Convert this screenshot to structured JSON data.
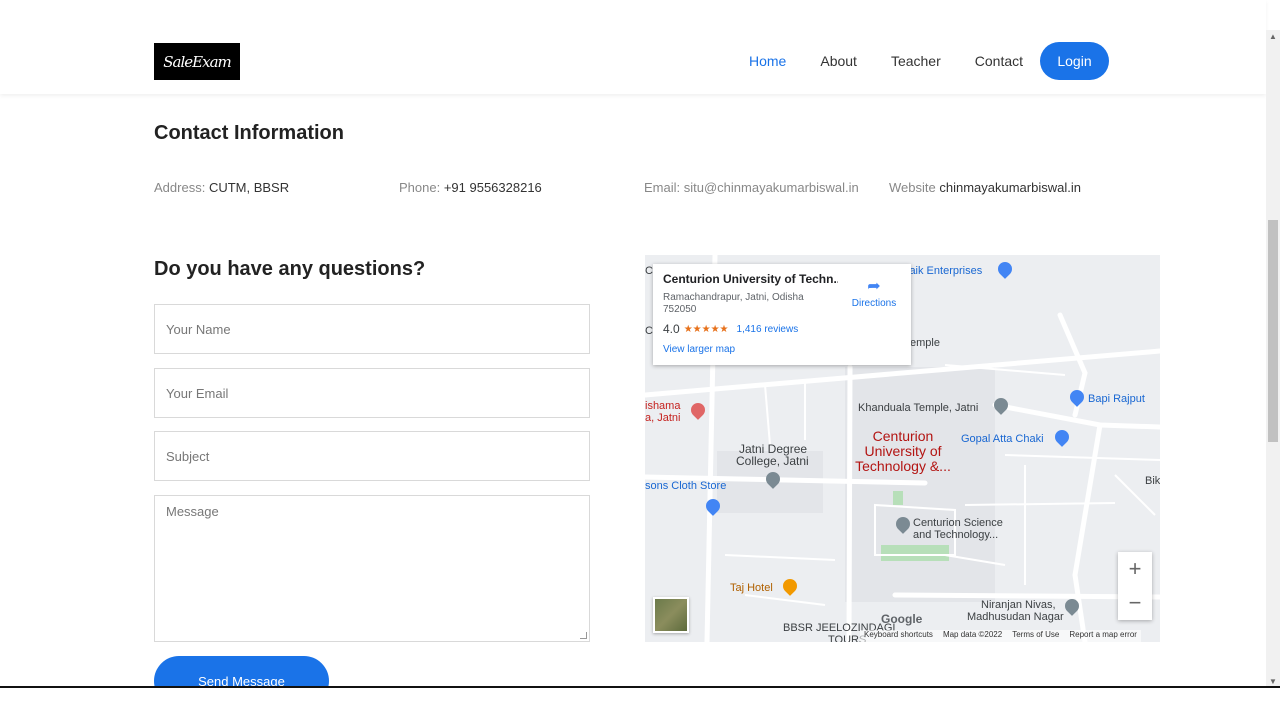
{
  "header": {
    "logo_text": "SaleExam",
    "nav": [
      "Home",
      "About",
      "Teacher",
      "Contact"
    ],
    "active_nav": "Home",
    "login_label": "Login"
  },
  "contact": {
    "title": "Contact Information",
    "address_label": "Address:",
    "address_value": "CUTM, BBSR",
    "phone_label": "Phone:",
    "phone_value": "+91 9556328216",
    "email_label": "Email: situ@chinmayakumarbiswal.in",
    "website_label": "Website",
    "website_value": "chinmayakumarbiswal.in"
  },
  "form": {
    "title": "Do you have any questions?",
    "name_placeholder": "Your Name",
    "email_placeholder": "Your Email",
    "subject_placeholder": "Subject",
    "message_placeholder": "Message",
    "send_label": "Send Message"
  },
  "map": {
    "card_title": "Centurion University of Techn...",
    "card_address": "Ramachandrapur, Jatni, Odisha 752050",
    "rating": "4.0",
    "stars": "★★★★★",
    "reviews": "1,416 reviews",
    "larger_map": "View larger map",
    "directions": "Directions",
    "labels": {
      "laik": "laik Enterprises",
      "emple": "emple",
      "bapi": "Bapi Rajput",
      "khanduala": "Khanduala Temple, Jatni",
      "gopal": "Gopal Atta Chaki",
      "ishama1": "ishama",
      "ishama2": "a, Jatni",
      "jatni_degree1": "Jatni Degree",
      "jatni_degree2": "College, Jatni",
      "centurion1": "Centurion",
      "centurion2": "University of",
      "centurion3": "Technology &...",
      "cloth": "sons Cloth Store",
      "centurion_sci1": "Centurion Science",
      "centurion_sci2": "and Technology...",
      "bik": "Bik",
      "taj": "Taj Hotel",
      "niranjan1": "Niranjan Nivas,",
      "niranjan2": "Madhusudan Nagar",
      "bbsr1": "BBSR JEELOZINDAGI",
      "bbsr2": "TOURS",
      "c1": "C",
      "c2": "C"
    },
    "google": "Google",
    "attrib": [
      "Keyboard shortcuts",
      "Map data ©2022",
      "Terms of Use",
      "Report a map error"
    ],
    "zoom_in": "+",
    "zoom_out": "−"
  }
}
